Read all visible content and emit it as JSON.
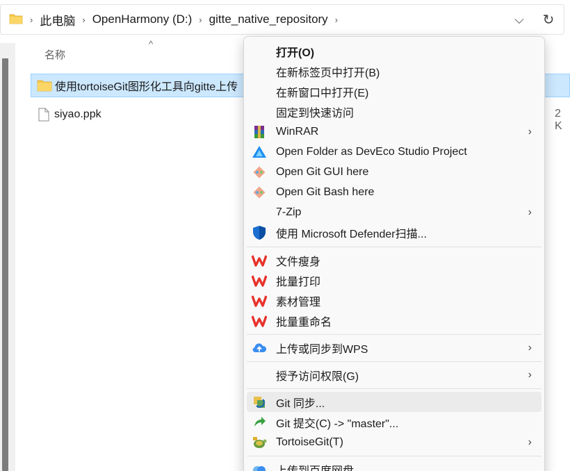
{
  "address_bar": {
    "breadcrumbs": [
      "此电脑",
      "OpenHarmony (D:)",
      "gitte_native_repository"
    ],
    "separator": "›",
    "dropdown_glyph": "⌵",
    "refresh_glyph": "↻"
  },
  "file_list": {
    "column_header": "名称",
    "sort_indicator": "^",
    "rows": [
      {
        "name": "使用tortoiseGit图形化工具向gitte上传",
        "type": "folder",
        "selected": true
      },
      {
        "name": "siyao.ppk",
        "type": "file",
        "selected": false,
        "size": "2 K"
      }
    ]
  },
  "context_menu": {
    "groups": [
      [
        {
          "label": "打开(O)",
          "bold": true
        },
        {
          "label": "在新标签页中打开(B)"
        },
        {
          "label": "在新窗口中打开(E)"
        },
        {
          "label": "固定到快速访问"
        },
        {
          "label": "WinRAR",
          "icon": "winrar-icon",
          "submenu": true
        },
        {
          "label": "Open Folder as DevEco Studio Project",
          "icon": "deveco-icon"
        },
        {
          "label": "Open Git GUI here",
          "icon": "git-gui-icon"
        },
        {
          "label": "Open Git Bash here",
          "icon": "git-bash-icon"
        },
        {
          "label": "7-Zip",
          "submenu": true
        },
        {
          "label": "使用 Microsoft Defender扫描...",
          "icon": "defender-shield-icon"
        }
      ],
      [
        {
          "label": "文件瘦身",
          "icon": "wps-icon"
        },
        {
          "label": "批量打印",
          "icon": "wps-icon"
        },
        {
          "label": "素材管理",
          "icon": "wps-icon"
        },
        {
          "label": "批量重命名",
          "icon": "wps-icon"
        }
      ],
      [
        {
          "label": "上传或同步到WPS",
          "icon": "cloud-upload-icon",
          "submenu": true
        }
      ],
      [
        {
          "label": "授予访问权限(G)",
          "submenu": true
        }
      ],
      [
        {
          "label": "Git 同步...",
          "icon": "git-sync-icon",
          "hover": true
        },
        {
          "label": "Git 提交(C) -> \"master\"...",
          "icon": "git-commit-icon"
        },
        {
          "label": "TortoiseGit(T)",
          "icon": "tortoisegit-icon",
          "submenu": true
        }
      ],
      [
        {
          "label": "上传到百度网盘",
          "icon": "baidu-netdisk-icon"
        }
      ]
    ],
    "submenu_glyph": "›"
  },
  "colors": {
    "selection_bg": "#cce8ff",
    "selection_border": "#99d1ff",
    "menu_bg": "#f9f9f9",
    "hover_bg": "#ebebeb",
    "wps_red": "#e8322b",
    "folder_yellow": "#f8c84a"
  }
}
